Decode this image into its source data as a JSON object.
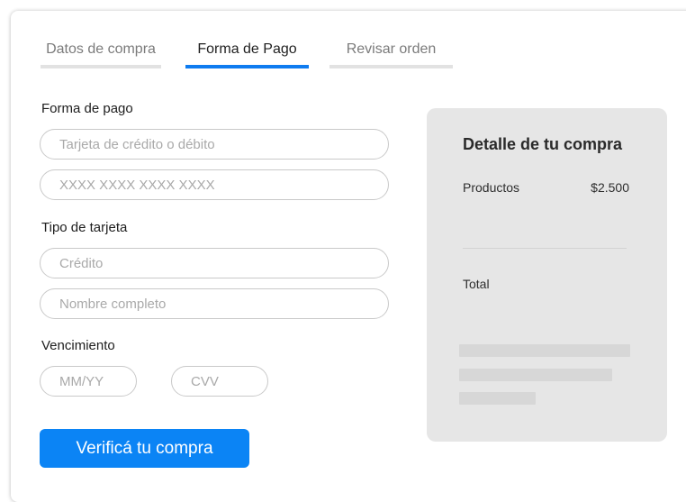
{
  "tabs": [
    {
      "label": "Datos de compra",
      "state": "inactive"
    },
    {
      "label": "Forma de Pago",
      "state": "active"
    },
    {
      "label": "Revisar orden",
      "state": "inactive"
    }
  ],
  "form": {
    "payment_method_label": "Forma de pago",
    "card_type_placeholder": "Tarjeta de crédito o débito",
    "card_number_placeholder": "XXXX XXXX XXXX XXXX",
    "card_kind_label": "Tipo de tarjeta",
    "card_kind_placeholder": "Crédito",
    "full_name_placeholder": "Nombre completo",
    "expiry_label": "Vencimiento",
    "expiry_placeholder": "MM/YY",
    "cvv_placeholder": "CVV",
    "submit_label": "Verificá tu compra"
  },
  "summary": {
    "title": "Detalle de tu compra",
    "products_label": "Productos",
    "products_value": "$2.500",
    "total_label": "Total"
  },
  "colors": {
    "accent": "#0b84f5",
    "tab_active_bar": "#0f7cf0",
    "tab_inactive_bar": "#e2e2e2",
    "summary_bg": "#e6e6e6"
  }
}
